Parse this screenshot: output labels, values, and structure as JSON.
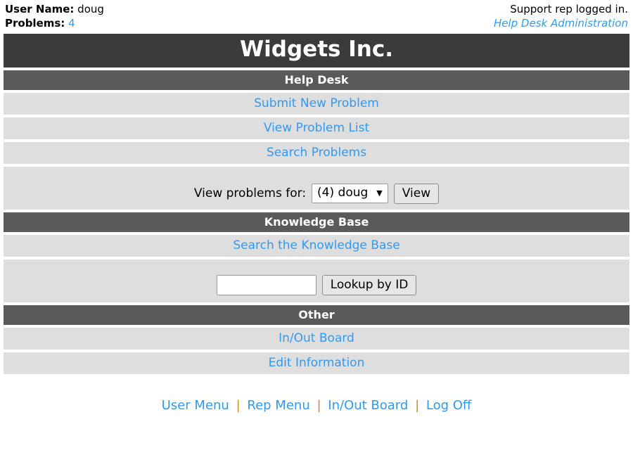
{
  "topbar": {
    "username_label": "User Name:",
    "username_value": "doug",
    "problems_label": "Problems:",
    "problems_count": "4",
    "status_note": "Support rep logged in.",
    "admin_link": "Help Desk Administration"
  },
  "title": "Widgets Inc.",
  "sections": {
    "help_desk": {
      "heading": "Help Desk",
      "links": [
        "Submit New Problem",
        "View Problem List",
        "Search Problems"
      ],
      "view_for_label": "View problems for:",
      "view_for_selected": "(4) doug",
      "view_for_options": [
        "(4) doug"
      ],
      "view_button": "View"
    },
    "knowledge_base": {
      "heading": "Knowledge Base",
      "search_link": "Search the Knowledge Base",
      "lookup_input_value": "",
      "lookup_input_placeholder": "",
      "lookup_button": "Lookup by ID"
    },
    "other": {
      "heading": "Other",
      "links": [
        "In/Out Board",
        "Edit Information"
      ]
    }
  },
  "footer": {
    "links": [
      "User Menu",
      "Rep Menu",
      "In/Out Board",
      "Log Off"
    ],
    "separator": "|"
  },
  "colors": {
    "title_bar": "#3b3b3b",
    "section_bar": "#5a5a5a",
    "row": "#dedede",
    "link": "#3399ee",
    "separator": "#c98b2e"
  }
}
